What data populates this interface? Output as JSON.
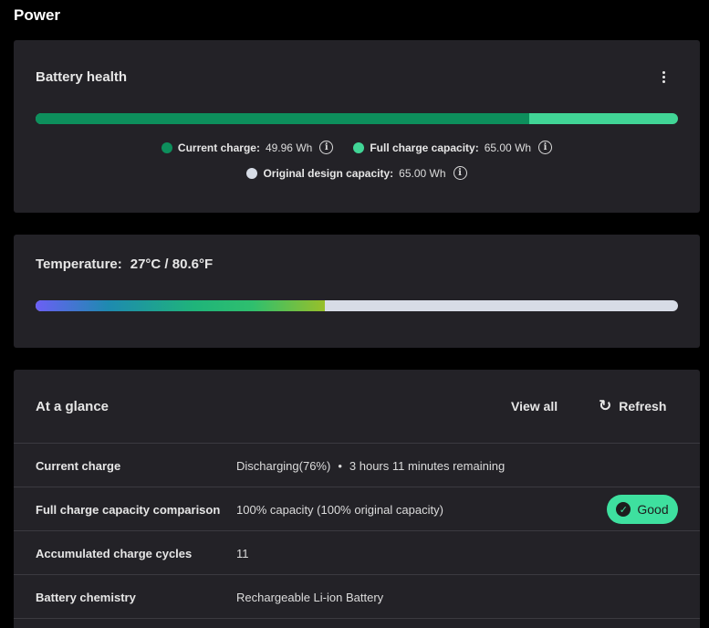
{
  "page": {
    "title": "Power"
  },
  "battery_health": {
    "title": "Battery health",
    "menu_icon": "more-vertical-icon",
    "current_charge_fraction": 0.7686,
    "legend": [
      {
        "label": "Current charge:",
        "value": "49.96 Wh",
        "color": "#0d8f5c"
      },
      {
        "label": "Full charge capacity:",
        "value": "65.00 Wh",
        "color": "#41d596"
      },
      {
        "label": "Original design capacity:",
        "value": "65.00 Wh",
        "color": "#d7dce6"
      }
    ]
  },
  "temperature": {
    "label": "Temperature:",
    "value": "27°C / 80.6°F",
    "level_fraction": 0.45
  },
  "at_a_glance": {
    "title": "At a glance",
    "view_all_label": "View all",
    "refresh_label": "Refresh",
    "refresh_icon": "refresh-icon",
    "rows": [
      {
        "label": "Current charge",
        "value": "Discharging(76%)",
        "value_extra": "3 hours 11 minutes remaining"
      },
      {
        "label": "Full charge capacity comparison",
        "value": "100% capacity (100% original capacity)",
        "badge": "Good"
      },
      {
        "label": "Accumulated charge cycles",
        "value": "11"
      },
      {
        "label": "Battery chemistry",
        "value": "Rechargeable Li-ion Battery"
      }
    ]
  },
  "colors": {
    "background": "#000000",
    "card": "#232227",
    "accent_green": "#3ee09f"
  }
}
